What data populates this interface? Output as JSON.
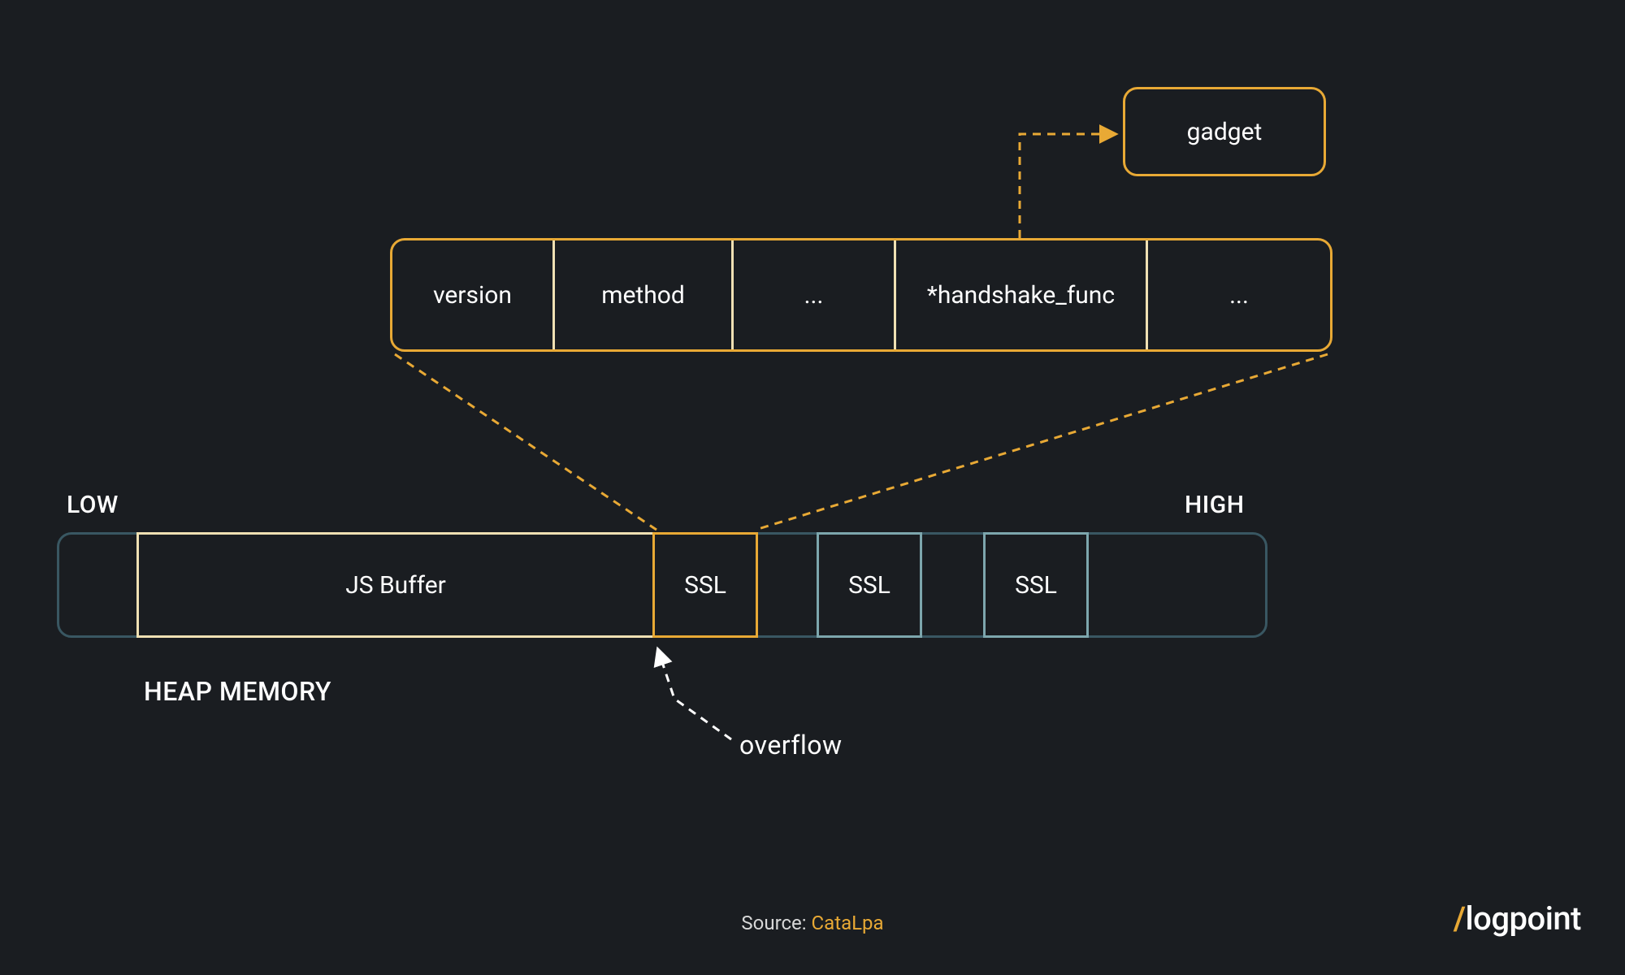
{
  "gadget": {
    "label": "gadget"
  },
  "struct": {
    "cells": [
      "version",
      "method",
      "...",
      "*handshake_func",
      "..."
    ]
  },
  "heap": {
    "low_label": "LOW",
    "high_label": "HIGH",
    "jsbuffer": "JS Buffer",
    "ssl": "SSL",
    "heap_memory_label": "HEAP MEMORY",
    "overflow_label": "overflow"
  },
  "source": {
    "prefix": "Source: ",
    "author": "CataLpa"
  },
  "brand": {
    "slash": "/",
    "name": "logpoint"
  },
  "colors": {
    "bg": "#1a1d21",
    "orange": "#e8a935",
    "cream": "#efe0b3",
    "teal": "#5a7e86",
    "white": "#ffffff"
  }
}
